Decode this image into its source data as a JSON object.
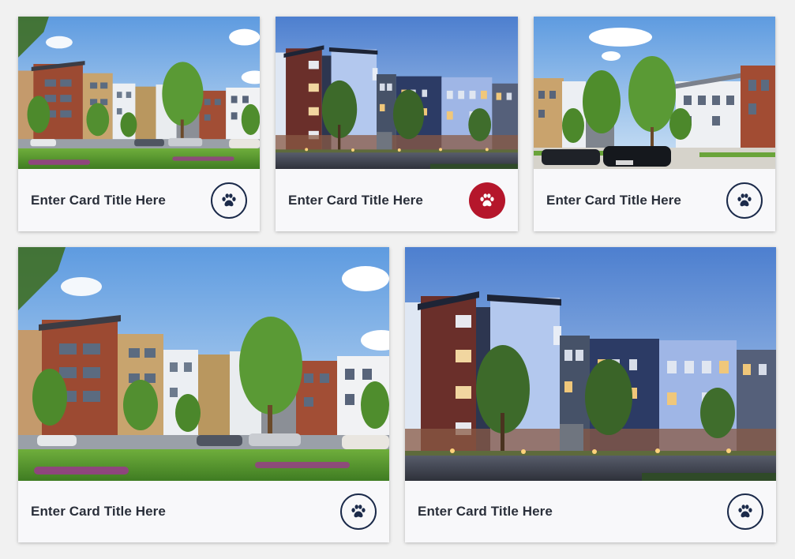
{
  "colors": {
    "background": "#f1f1f1",
    "card_bg": "#f8f8fa",
    "title_text": "#2a2f3a",
    "navy": "#1b2a4a",
    "accent_red": "#b5162b"
  },
  "cards": [
    {
      "title": "Enter Card Title Here",
      "icon": "paw-icon",
      "button_style": "outline",
      "image": "daytime-apartment-complex-rendering"
    },
    {
      "title": "Enter Card Title Here",
      "icon": "paw-icon",
      "button_style": "filled-red",
      "image": "dusk-apartment-building-rendering"
    },
    {
      "title": "Enter Card Title Here",
      "icon": "paw-icon",
      "button_style": "outline",
      "image": "daytime-courtyard-apartment-rendering"
    },
    {
      "title": "Enter Card Title Here",
      "icon": "paw-icon",
      "button_style": "outline",
      "image": "daytime-apartment-complex-rendering"
    },
    {
      "title": "Enter Card Title Here",
      "icon": "paw-icon",
      "button_style": "outline",
      "image": "dusk-apartment-building-rendering"
    }
  ]
}
